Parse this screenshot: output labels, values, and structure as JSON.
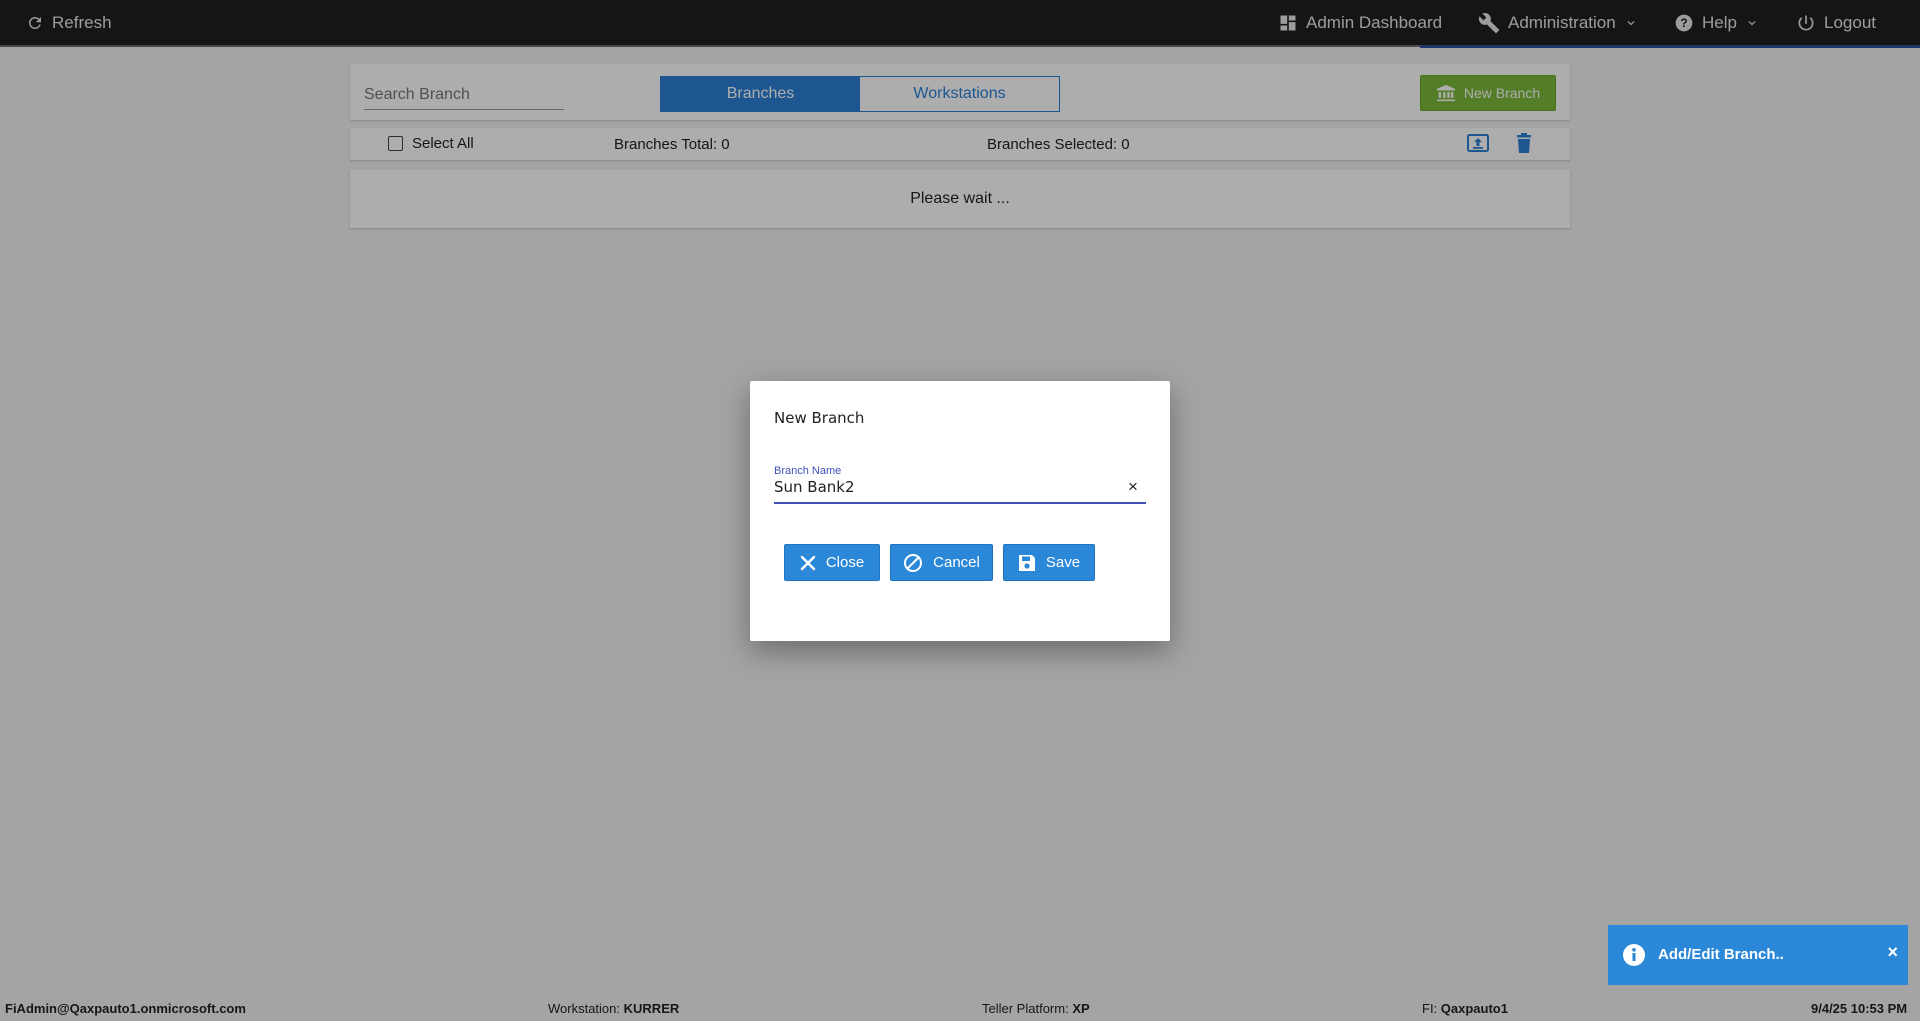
{
  "topbar": {
    "refresh": "Refresh",
    "admin_dashboard": "Admin Dashboard",
    "administration": "Administration",
    "help": "Help",
    "logout": "Logout"
  },
  "toolbar": {
    "search_placeholder": "Search Branch",
    "tabs": [
      {
        "label": "Branches",
        "active": true
      },
      {
        "label": "Workstations",
        "active": false
      }
    ],
    "new_branch": "New Branch"
  },
  "summary": {
    "select_all": "Select All",
    "branches_total": "Branches Total: 0",
    "branches_selected": "Branches Selected: 0"
  },
  "status": {
    "wait": "Please wait ..."
  },
  "dialog": {
    "title": "New Branch",
    "field_label": "Branch Name",
    "field_value": "Sun Bank2",
    "clear": "×",
    "close": "Close",
    "cancel": "Cancel",
    "save": "Save"
  },
  "toast": {
    "message": "Add/Edit Branch..",
    "close": "×"
  },
  "footer": {
    "user": "FiAdmin@Qaxpauto1.onmicrosoft.com",
    "workstation_label": "Workstation:",
    "workstation_value": "KURRER",
    "platform_label": "Teller Platform:",
    "platform_value": "XP",
    "fi_label": "FI:",
    "fi_value": "Qaxpauto1",
    "datetime": "9/4/25 10:53 PM"
  },
  "colors": {
    "primary": "#2b87d8",
    "success": "#7cb83a",
    "topbar": "#1f1f1f",
    "accent": "#3f51b5"
  }
}
